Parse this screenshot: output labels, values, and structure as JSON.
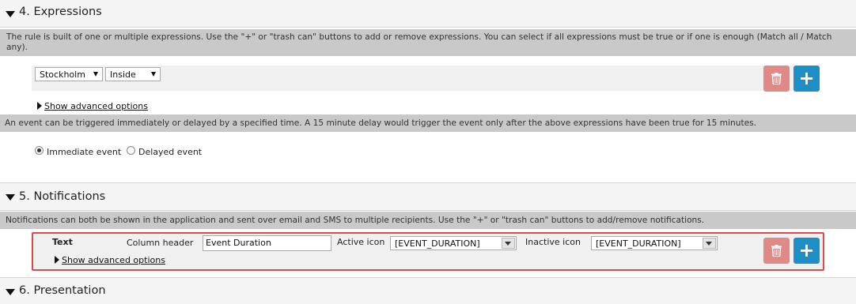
{
  "section4": {
    "title": "4. Expressions",
    "info": "The rule is built of one or multiple expressions. Use the \"+\" or \"trash can\" buttons to add or remove expressions. You can select if all expressions must be true or if one is enough (Match all / Match any).",
    "location_select": "Stockholm",
    "condition_select": "Inside",
    "advanced_link": "Show advanced options",
    "delay_info": "An event can be triggered immediately or delayed by a specified time. A 15 minute delay would trigger the event only after the above expressions have been true for 15 minutes.",
    "immediate_label": "Immediate event",
    "delayed_label": "Delayed event",
    "immediate_selected": true
  },
  "section5": {
    "title": "5. Notifications",
    "info": "Notifications can both be shown in the application and sent over email and SMS to multiple recipients. Use the \"+\" or \"trash can\" buttons to add/remove notifications.",
    "row": {
      "type": "Text",
      "column_header_label": "Column header",
      "column_header_value": "Event Duration",
      "active_icon_label": "Active icon",
      "active_icon_value": "[EVENT_DURATION]",
      "inactive_icon_label": "Inactive icon",
      "inactive_icon_value": "[EVENT_DURATION]",
      "advanced_link": "Show advanced options"
    }
  },
  "section6": {
    "title": "6. Presentation"
  },
  "icons": {
    "collapse": "triangle-down-icon",
    "expand": "triangle-right-icon",
    "trash": "trash-icon",
    "add": "plus-icon"
  },
  "colors": {
    "add_button": "#1e8fc6",
    "trash_button": "#e08a88",
    "highlight": "#e0494c",
    "info_bar": "#c9c9c9",
    "section_header": "#f4f4f4"
  }
}
